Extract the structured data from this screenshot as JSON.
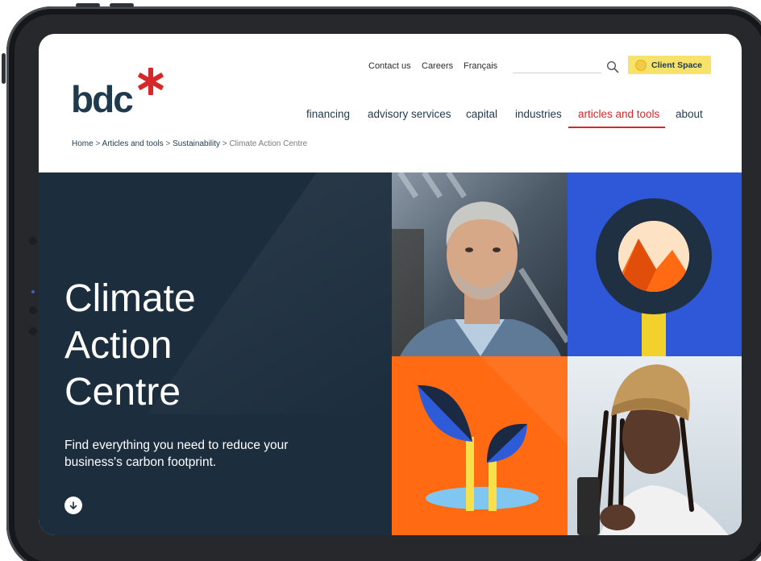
{
  "header": {
    "logo_text": "bdc",
    "utility_links": [
      "Contact us",
      "Careers",
      "Français"
    ],
    "search": {
      "placeholder": ""
    },
    "client_space_label": "Client Space"
  },
  "nav": {
    "items": [
      "financing",
      "advisory services",
      "capital",
      "industries",
      "articles and tools",
      "about"
    ],
    "active": "articles and tools"
  },
  "breadcrumb": {
    "items": [
      "Home",
      "Articles and tools",
      "Sustainability"
    ],
    "separator": ">",
    "current": "Climate Action Centre"
  },
  "hero": {
    "title_lines": [
      "Climate",
      "Action",
      "Centre"
    ],
    "subtitle": "Find everything you need to reduce your business's carbon footprint.",
    "scroll_icon": "arrow-down-icon"
  },
  "tiles": [
    {
      "name": "photo-man",
      "kind": "photo"
    },
    {
      "name": "magnifier-illustration",
      "kind": "illustration"
    },
    {
      "name": "sprout-illustration",
      "kind": "illustration"
    },
    {
      "name": "photo-woman",
      "kind": "photo"
    }
  ],
  "colors": {
    "brand_navy": "#1f3a4d",
    "brand_red": "#d62828",
    "hero_bg": "#1c2d3d",
    "accent_yellow": "#f7e26b",
    "tile_blue": "#2f58d9",
    "tile_orange": "#ff6a13"
  }
}
